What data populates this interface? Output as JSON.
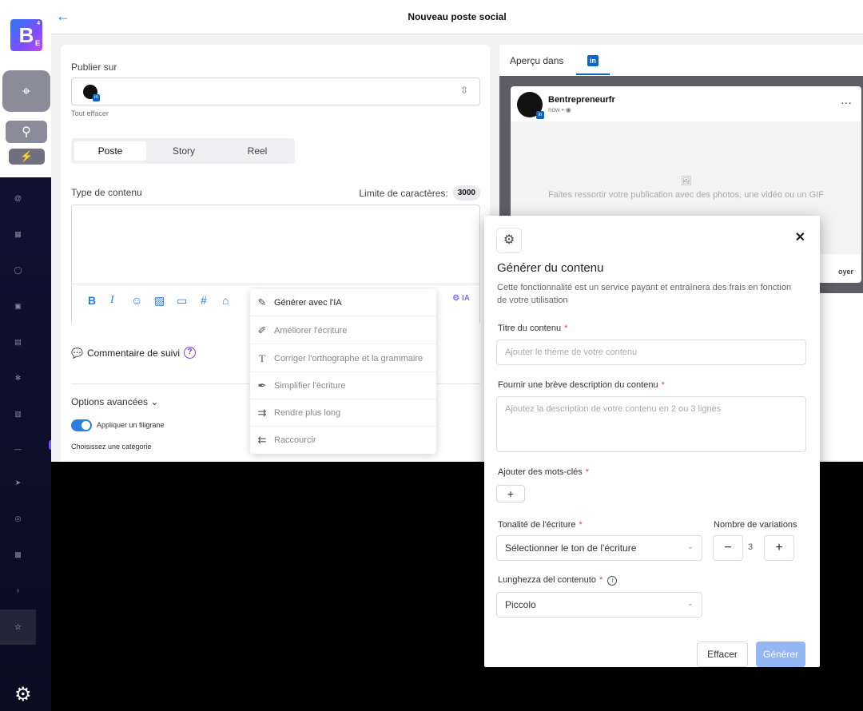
{
  "app": {
    "title": "Nouveau poste social"
  },
  "brand": {
    "logo_letter": "B",
    "logo_sub": "E",
    "logo_sup": "4",
    "accent": "#2a7de1",
    "purple": "#7c4dff"
  },
  "rail": {
    "icons": [
      "pointer-icon",
      "search-icon",
      "bolt-icon",
      "at-icon",
      "grid-icon",
      "chat-icon",
      "calendar-icon",
      "inbox-icon",
      "asterisk-icon",
      "building-icon",
      "dash-icon",
      "send-icon",
      "globe-icon",
      "calendar-check-icon",
      "bulb-icon",
      "star-icon",
      "gear-icon"
    ]
  },
  "composer": {
    "publish_label": "Publier sur",
    "clear_all": "Tout effacer",
    "tabs": [
      {
        "label": "Poste",
        "active": true
      },
      {
        "label": "Story",
        "active": false
      },
      {
        "label": "Reel",
        "active": false
      }
    ],
    "content_type_label": "Type de contenu",
    "char_limit_label": "Limite de caractères:",
    "char_limit_value": "3000",
    "ia_label": "IA",
    "followup_label": "Commentaire de suivi",
    "followup_help": "?",
    "advanced_label": "Options avancées",
    "watermark_label": "Appliquer un filigrane",
    "category_label": "Choisissez une catégorie"
  },
  "ai_menu": {
    "items": [
      {
        "label": "Générer avec l'IA",
        "icon": "pen-icon"
      },
      {
        "label": "Améliorer l'écriture",
        "icon": "pencil-line-icon"
      },
      {
        "label": "Corriger l'orthographe et la grammaire",
        "icon": "text-t-icon"
      },
      {
        "label": "Simplifier l'écriture",
        "icon": "feather-icon"
      },
      {
        "label": "Rendre plus long",
        "icon": "arrow-extend-icon"
      },
      {
        "label": "Raccourcir",
        "icon": "arrow-shorten-icon"
      }
    ]
  },
  "preview": {
    "tab_label": "Aperçu dans",
    "network": "in",
    "account_name": "Bentrepreneurfr",
    "post_time": "now • ",
    "more": "···",
    "media_icon": "🖼",
    "media_hint": "Faites ressortir votre publication avec des photos, une vidéo ou un GIF",
    "send_fragment": "oyer"
  },
  "modal": {
    "title": "Générer du contenu",
    "description": "Cette fonctionnalité est un service payant et entraînera des frais en fonction de votre utilisation",
    "title_label": "Titre du contenu",
    "title_placeholder": "Ajouter le thème de votre contenu",
    "desc_label": "Fournir une brève description du contenu",
    "desc_placeholder": "Ajoutez la description de votre contenu en 2 ou 3 lignes",
    "keywords_label": "Ajouter des mots-clés",
    "keywords_add": "+",
    "tone_label": "Tonalité de l'écriture",
    "tone_value": "Sélectionner le ton de l'écriture",
    "variations_label": "Nombre de variations",
    "variations_value": "3",
    "length_label": "Lunghezza del contenuto",
    "length_value": "Piccolo",
    "required_mark": "*",
    "clear_button": "Effacer",
    "generate_button": "Générer",
    "close": "✕"
  }
}
